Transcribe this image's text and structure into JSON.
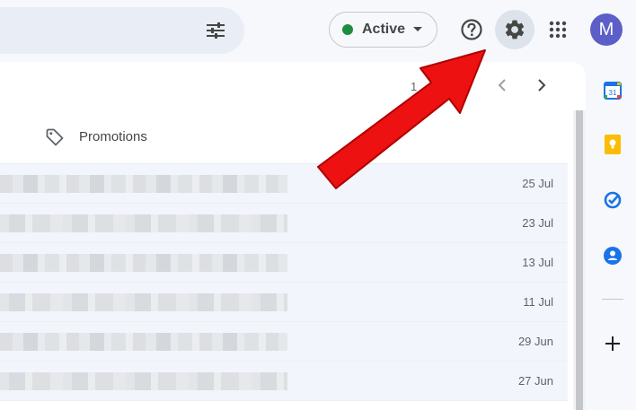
{
  "header": {
    "status_label": "Active",
    "avatar_letter": "M"
  },
  "colors": {
    "status_active": "#1e8e3e",
    "avatar_bg": "#5b5fc7",
    "annotation_red": "#ee1111"
  },
  "toolbar": {
    "page_range": "1"
  },
  "tabs": [
    {
      "label": "Promotions",
      "icon": "tag-icon"
    }
  ],
  "mail": {
    "rows": [
      {
        "date": "25 Jul"
      },
      {
        "date": "23 Jul"
      },
      {
        "date": "13 Jul"
      },
      {
        "date": "11 Jul"
      },
      {
        "date": "29 Jun"
      },
      {
        "date": "27 Jun"
      }
    ]
  },
  "side_apps": [
    {
      "name": "calendar-icon",
      "label": "31"
    },
    {
      "name": "keep-icon"
    },
    {
      "name": "tasks-icon"
    },
    {
      "name": "contacts-icon"
    },
    {
      "name": "add-icon"
    }
  ]
}
